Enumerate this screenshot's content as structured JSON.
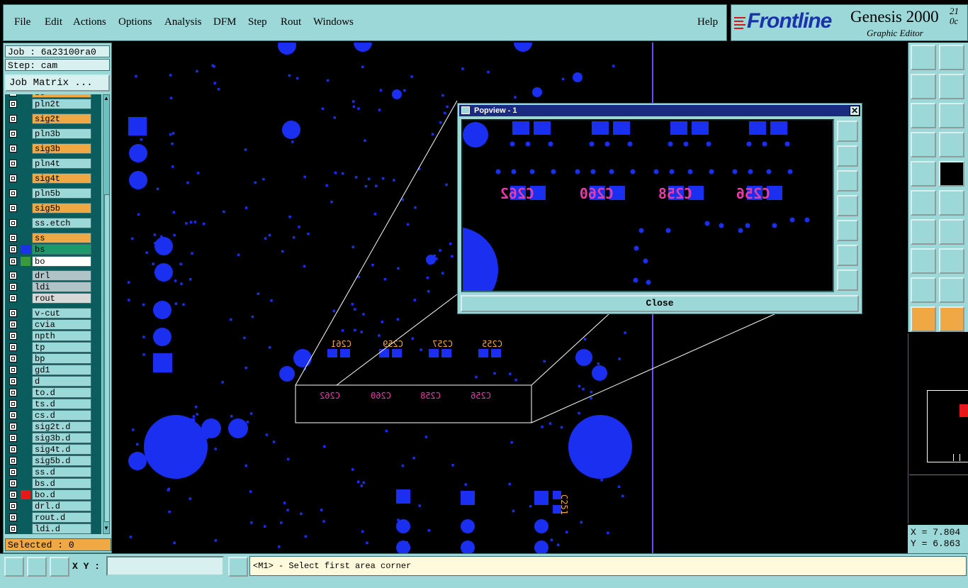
{
  "menu": {
    "items": [
      "File",
      "Edit",
      "Actions",
      "Options",
      "Analysis",
      "DFM",
      "Step",
      "Rout",
      "Windows"
    ],
    "help": "Help"
  },
  "logo": {
    "brand": "Frontline",
    "title": "Genesis 2000",
    "subtitle": "Graphic Editor",
    "version": "21",
    "version2": "0c"
  },
  "job": {
    "job_label": "Job : 6a23100ra0",
    "step_label": "Step: cam",
    "matrix_button": "Job Matrix ..."
  },
  "layers": [
    {
      "name": "so",
      "color": "#f0a844",
      "swatch": ""
    },
    {
      "name": "pln2t",
      "color": "#9cd8d8",
      "swatch": ""
    },
    {
      "name": "sig2t",
      "color": "#f0a844",
      "swatch": ""
    },
    {
      "name": "pln3b",
      "color": "#9cd8d8",
      "swatch": ""
    },
    {
      "name": "sig3b",
      "color": "#f0a844",
      "swatch": ""
    },
    {
      "name": "pln4t",
      "color": "#9cd8d8",
      "swatch": ""
    },
    {
      "name": "sig4t",
      "color": "#f0a844",
      "swatch": ""
    },
    {
      "name": "pln5b",
      "color": "#9cd8d8",
      "swatch": ""
    },
    {
      "name": "sig5b",
      "color": "#f0a844",
      "swatch": ""
    },
    {
      "name": "ss.etch",
      "color": "#9cd8d8",
      "swatch": ""
    },
    {
      "name": "ss",
      "color": "#f0a844",
      "swatch": ""
    },
    {
      "name": "bs",
      "color": "#1a9a6a",
      "swatch": "#1a33e8"
    },
    {
      "name": "bo",
      "color": "#ffffff",
      "swatch": "#3a9a3a"
    },
    {
      "name": "drl",
      "color": "#b0c4c8",
      "swatch": ""
    },
    {
      "name": "ldi",
      "color": "#b0c4c8",
      "swatch": ""
    },
    {
      "name": "rout",
      "color": "#d8d8d8",
      "swatch": ""
    },
    {
      "name": "v-cut",
      "color": "#9cd8d8",
      "swatch": ""
    },
    {
      "name": "cvia",
      "color": "#9cd8d8",
      "swatch": ""
    },
    {
      "name": "npth",
      "color": "#9cd8d8",
      "swatch": ""
    },
    {
      "name": "tp",
      "color": "#9cd8d8",
      "swatch": ""
    },
    {
      "name": "bp",
      "color": "#9cd8d8",
      "swatch": ""
    },
    {
      "name": "gd1",
      "color": "#9cd8d8",
      "swatch": ""
    },
    {
      "name": "d",
      "color": "#9cd8d8",
      "swatch": ""
    },
    {
      "name": "to.d",
      "color": "#9cd8d8",
      "swatch": ""
    },
    {
      "name": "ts.d",
      "color": "#9cd8d8",
      "swatch": ""
    },
    {
      "name": "cs.d",
      "color": "#9cd8d8",
      "swatch": ""
    },
    {
      "name": "sig2t.d",
      "color": "#9cd8d8",
      "swatch": ""
    },
    {
      "name": "sig3b.d",
      "color": "#9cd8d8",
      "swatch": ""
    },
    {
      "name": "sig4t.d",
      "color": "#9cd8d8",
      "swatch": ""
    },
    {
      "name": "sig5b.d",
      "color": "#9cd8d8",
      "swatch": ""
    },
    {
      "name": "ss.d",
      "color": "#9cd8d8",
      "swatch": ""
    },
    {
      "name": "bs.d",
      "color": "#9cd8d8",
      "swatch": ""
    },
    {
      "name": "bo.d",
      "color": "#9cd8d8",
      "swatch": "#e81818"
    },
    {
      "name": "drl.d",
      "color": "#9cd8d8",
      "swatch": ""
    },
    {
      "name": "rout.d",
      "color": "#9cd8d8",
      "swatch": ""
    },
    {
      "name": "ldi.d",
      "color": "#9cd8d8",
      "swatch": ""
    }
  ],
  "selected_label": "Selected : 0",
  "popview": {
    "title": "Popview - 1",
    "close_label": "Close",
    "component_labels": [
      "C262",
      "C260",
      "C258",
      "C256"
    ]
  },
  "board_labels": {
    "top_row": [
      "C261",
      "C259",
      "C257",
      "C255"
    ],
    "bottom_row": [
      "C262",
      "C260",
      "C258",
      "C256"
    ],
    "side": "C251"
  },
  "coords": {
    "x_label": "X = 7.804",
    "y_label": "Y = 6.863"
  },
  "bottom": {
    "xy_label": "X Y :",
    "xy_value": "",
    "prompt": "<M1> - Select first area corner"
  },
  "colors": {
    "panel": "#9cd8d8",
    "pad_blue": "#1a2ff0",
    "highlight": "#f0a844",
    "label_magenta": "#e83aa8"
  }
}
